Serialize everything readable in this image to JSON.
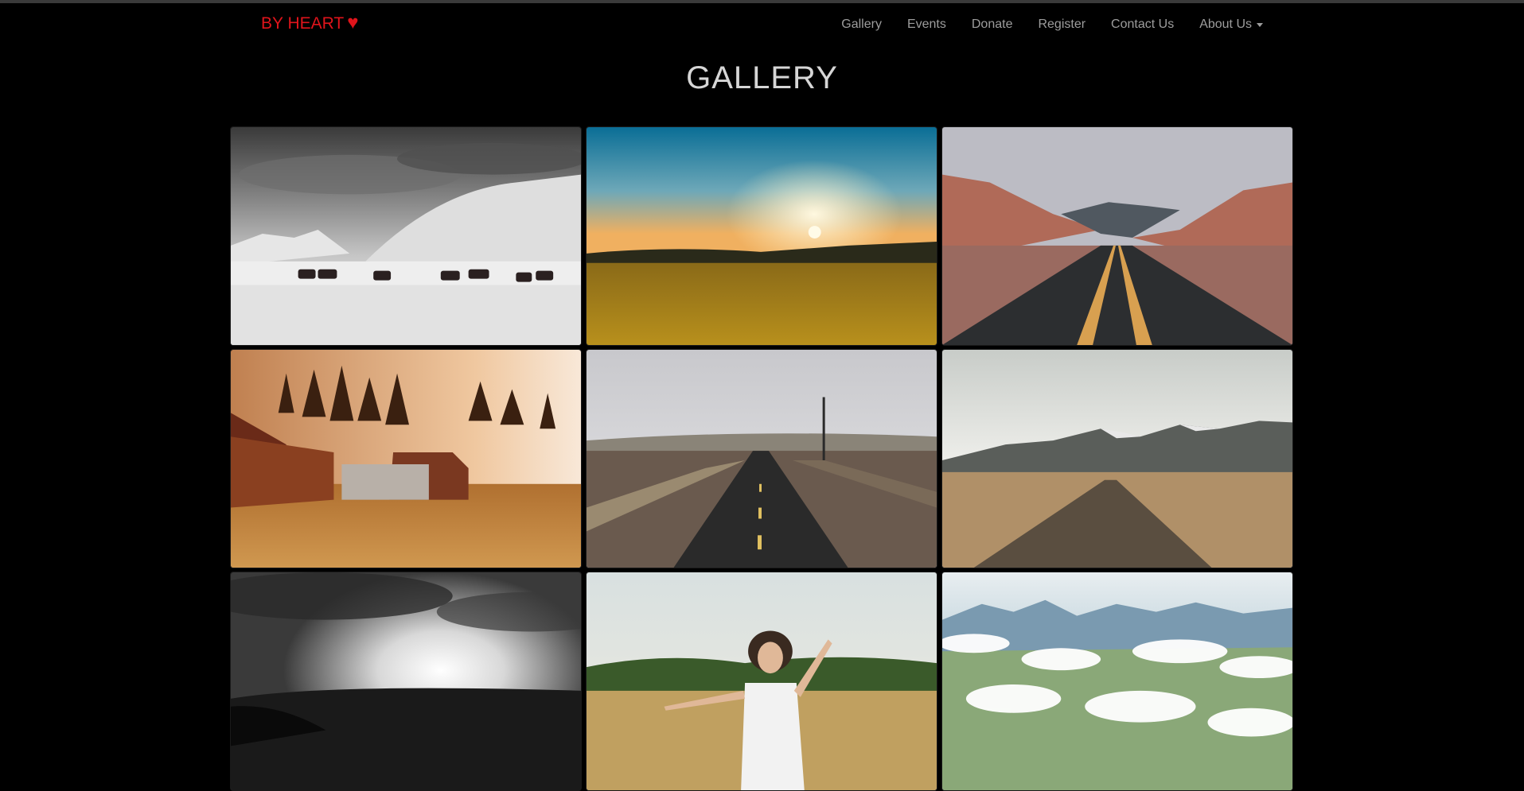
{
  "brand": {
    "text": "BY HEART",
    "heart": "♥",
    "color": "#e0141b"
  },
  "nav": {
    "items": [
      {
        "label": "Gallery"
      },
      {
        "label": "Events"
      },
      {
        "label": "Donate"
      },
      {
        "label": "Register"
      },
      {
        "label": "Contact Us"
      },
      {
        "label": "About Us",
        "dropdown": true
      }
    ]
  },
  "page": {
    "title": "GALLERY"
  },
  "gallery": {
    "images": [
      {
        "subject": "horses-in-snow"
      },
      {
        "subject": "sunset-wheat-field"
      },
      {
        "subject": "desert-road"
      },
      {
        "subject": "barn-at-sunset"
      },
      {
        "subject": "countryside-road"
      },
      {
        "subject": "mountain-gravel-road"
      },
      {
        "subject": "monochrome-sun-landscape"
      },
      {
        "subject": "girl-in-field"
      },
      {
        "subject": "mountains-above-clouds"
      }
    ]
  }
}
